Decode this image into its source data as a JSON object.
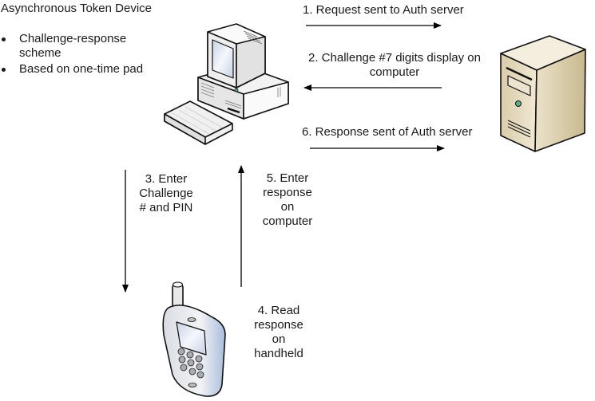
{
  "diagram": {
    "title": "Asynchronous Token Device",
    "bullets": [
      "Challenge-response scheme",
      "Based on one-time pad"
    ],
    "nodes": {
      "computer": {
        "label": "computer",
        "icon": "desktop-computer-icon"
      },
      "server": {
        "label": "Auth server",
        "icon": "tower-server-icon"
      },
      "handheld": {
        "label": "handheld",
        "icon": "mobile-phone-icon"
      }
    },
    "steps": [
      {
        "id": 1,
        "text": "1. Request sent to Auth server",
        "from": "computer",
        "to": "server"
      },
      {
        "id": 2,
        "text_line1": "2. Challenge #7 digits display on",
        "text_line2": "computer",
        "from": "server",
        "to": "computer"
      },
      {
        "id": 3,
        "text_lines": [
          "3. Enter",
          "Challenge",
          "# and PIN"
        ],
        "from": "computer",
        "to": "handheld"
      },
      {
        "id": 4,
        "text_lines": [
          "4. Read",
          "response",
          "on",
          "handheld"
        ],
        "from": "handheld",
        "to": "handheld"
      },
      {
        "id": 5,
        "text_lines": [
          "5. Enter",
          "response",
          "on",
          "computer"
        ],
        "from": "handheld",
        "to": "computer"
      },
      {
        "id": 6,
        "text": "6. Response sent of Auth server",
        "from": "computer",
        "to": "server"
      }
    ],
    "colors": {
      "line": "#000000",
      "text": "#1a1a1a",
      "server_body": "#e8dcc0",
      "phone_body": "#c9d6e8",
      "screen": "#dfe8f4"
    }
  }
}
